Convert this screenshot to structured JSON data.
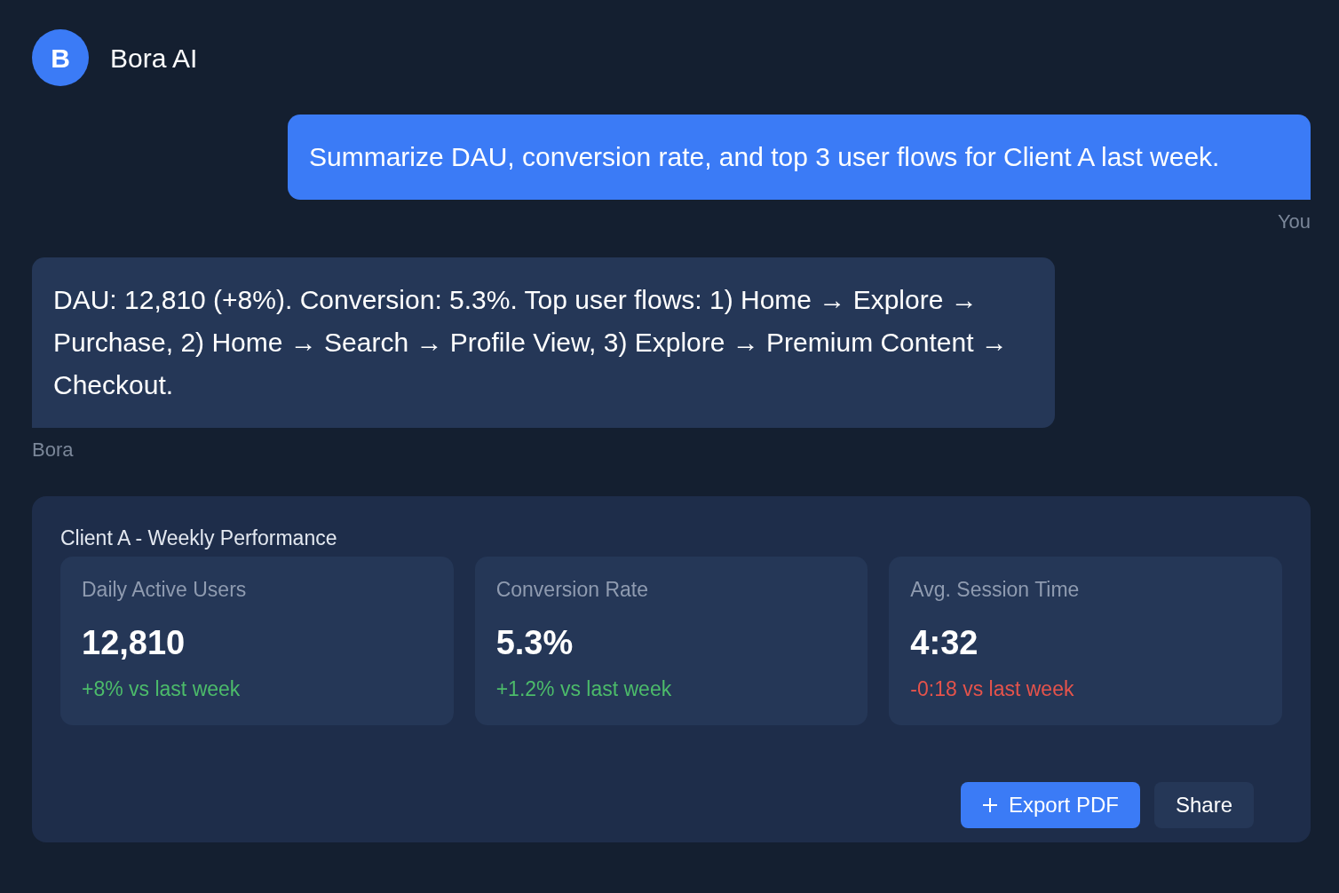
{
  "header": {
    "avatar_letter": "B",
    "title": "Bora AI"
  },
  "messages": [
    {
      "kind": "user",
      "text": "Summarize DAU, conversion rate, and top 3 user flows for Client A last week.",
      "sender": "You"
    },
    {
      "kind": "bot",
      "text": "DAU: 12,810 (+8%). Conversion: 5.3%. Top user flows: 1) Home → Explore → Purchase, 2) Home → Search → Profile View, 3) Explore → Premium Content → Checkout.",
      "sender": "Bora"
    }
  ],
  "report": {
    "title": "Client A - Weekly Performance",
    "metrics": [
      {
        "label": "Daily Active Users",
        "value": "12,810",
        "change": "+8% vs last week",
        "color": "#4cbb6a"
      },
      {
        "label": "Conversion Rate",
        "value": "5.3%",
        "change": "+1.2% vs last week",
        "color": "#4cbb6a"
      },
      {
        "label": "Avg. Session Time",
        "value": "4:32",
        "change": "-0:18 vs last week",
        "color": "#e5534b"
      }
    ],
    "buttons": [
      {
        "label": "Export PDF",
        "kind": "primary"
      },
      {
        "label": "Share",
        "kind": "secondary"
      }
    ]
  }
}
